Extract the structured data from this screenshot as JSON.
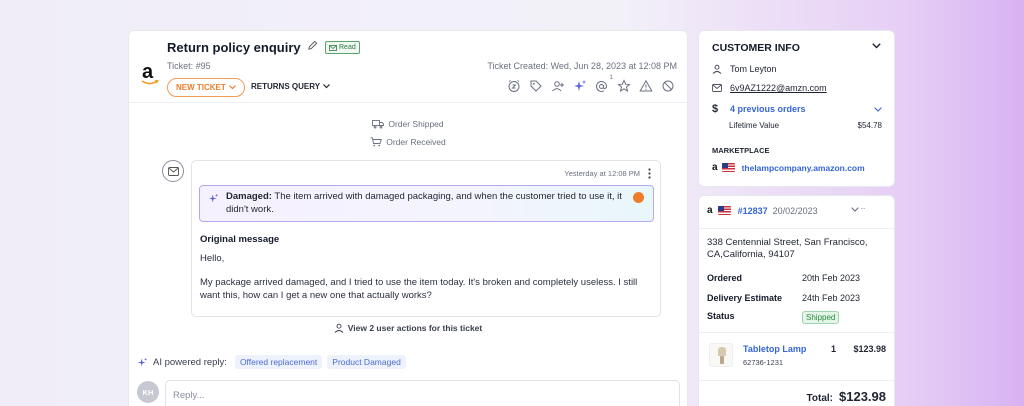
{
  "ticket": {
    "title": "Return policy enquiry",
    "read_badge": "Read",
    "number": "Ticket: #95",
    "created": "Ticket Created: Wed, Jun 28, 2023 at 12:08 PM",
    "status_label": "NEW TICKET",
    "category_label": "RETURNS QUERY"
  },
  "toolbar_icons": [
    "snooze-icon",
    "tag-icon",
    "assign-user-icon",
    "ai-sparkle-icon",
    "mention-icon",
    "star-icon",
    "warning-icon",
    "block-icon"
  ],
  "mention_count": "1",
  "events": {
    "shipped": "Order Shipped",
    "received": "Order Received"
  },
  "message": {
    "time": "Yesterday at 12:08 PM",
    "ai_label": "Damaged:",
    "ai_text": "The item arrived with damaged packaging, and when the customer tried to use it, it didn't work.",
    "original_label": "Original message",
    "greeting": "Hello,",
    "body": "My package arrived damaged, and I tried to use the item today. It's broken and completely useless. I still want this, how can I get a new one that actually works?"
  },
  "user_actions": "View 2 user actions for this ticket",
  "ai_reply": {
    "label": "AI powered reply:",
    "chips": [
      "Offered replacement",
      "Product Damaged"
    ]
  },
  "reply": {
    "avatar_initials": "KH",
    "placeholder": "Reply..."
  },
  "customer": {
    "heading": "CUSTOMER INFO",
    "name": "Tom Leyton",
    "email": "6v9AZ1222@amzn.com",
    "currency_symbol": "$",
    "previous_orders": "4 previous orders",
    "lifetime_label": "Lifetime Value",
    "lifetime_value": "$54.78",
    "marketplace_label": "MARKETPLACE",
    "marketplace": "thelampcompany.amazon.com"
  },
  "order": {
    "id": "#12837",
    "date": "20/02/2023",
    "address": "338 Centennial Street, San Francisco, CA,California, 94107",
    "ordered_label": "Ordered",
    "ordered": "20th Feb 2023",
    "delivery_label": "Delivery Estimate",
    "delivery": "24th Feb 2023",
    "status_label": "Status",
    "status": "Shipped",
    "product_name": "Tabletop Lamp",
    "product_sku": "62736-1231",
    "product_qty": "1",
    "product_price": "$123.98",
    "total_label": "Total:",
    "total": "$123.98"
  },
  "colors": {
    "accent_blue": "#3565d6",
    "orange": "#ee7f2e",
    "ai_purple": "#5e62d8",
    "shipped_green": "#2e8a47"
  }
}
